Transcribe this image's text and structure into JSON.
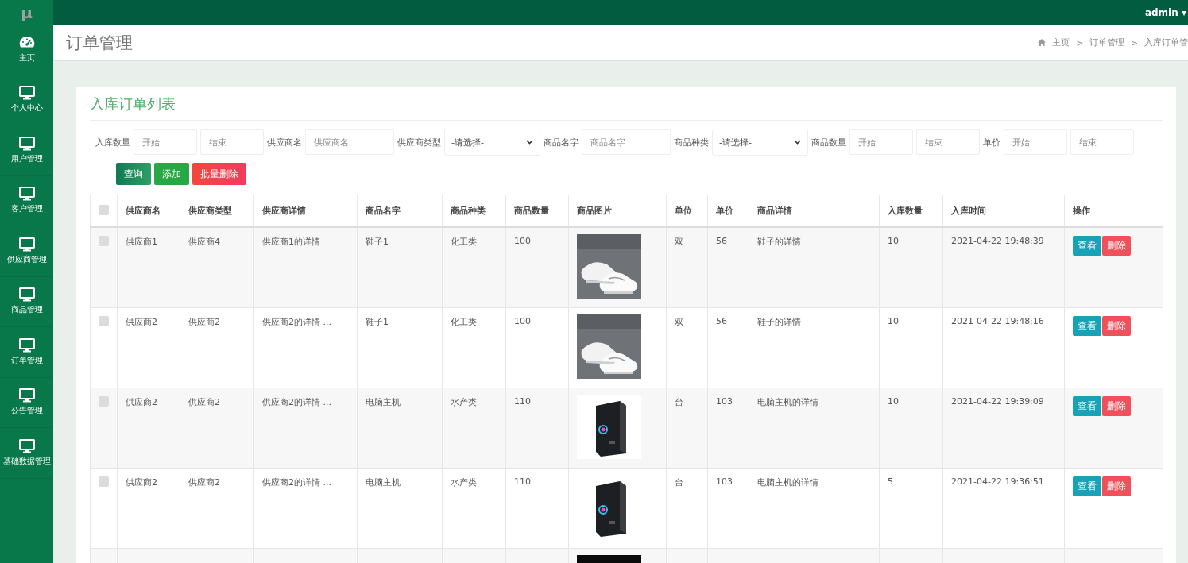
{
  "logo": "μ",
  "user_menu": {
    "label": "admin",
    "caret": "▾"
  },
  "sidebar": {
    "items": [
      {
        "label": "主页"
      },
      {
        "label": "个人中心"
      },
      {
        "label": "用户管理"
      },
      {
        "label": "客户管理"
      },
      {
        "label": "供应商管理"
      },
      {
        "label": "商品管理"
      },
      {
        "label": "订单管理"
      },
      {
        "label": "公告管理"
      },
      {
        "label": "基础数据管理"
      }
    ]
  },
  "page_title": "订单管理",
  "breadcrumb": [
    "主页",
    "订单管理",
    "入库订单管"
  ],
  "breadcrumb_separator": ">",
  "card_title": "入库订单列表",
  "filters": [
    {
      "kind": "range",
      "label": "入库数量",
      "placeholders": [
        "开始",
        "结束"
      ]
    },
    {
      "kind": "text",
      "label": "供应商名",
      "placeholder": "供应商名"
    },
    {
      "kind": "select",
      "label": "供应商类型",
      "value": "-请选择-"
    },
    {
      "kind": "text",
      "label": "商品名字",
      "placeholder": "商品名字"
    },
    {
      "kind": "select",
      "label": "商品种类",
      "value": "-请选择-"
    },
    {
      "kind": "range",
      "label": "商品数量",
      "placeholders": [
        "开始",
        "结束"
      ]
    },
    {
      "kind": "range",
      "label": "单价",
      "placeholders": [
        "开始",
        "结束"
      ]
    }
  ],
  "actions": [
    {
      "label": "查询",
      "kind": "search"
    },
    {
      "label": "添加",
      "kind": "add"
    },
    {
      "label": "批量删除",
      "kind": "delete"
    }
  ],
  "table": {
    "select_all_checked": false,
    "columns": [
      "供应商名",
      "供应商类型",
      "供应商详情",
      "商品名字",
      "商品种类",
      "商品数量",
      "商品图片",
      "单位",
      "单价",
      "商品详情",
      "入库数量",
      "入库时间",
      "操作"
    ],
    "rows": [
      {
        "checked": false,
        "cells": [
          "供应商1",
          "供应商4",
          "供应商1的详情",
          "鞋子1",
          "化工类",
          "100"
        ],
        "cells_after": [
          "双",
          "56",
          "鞋子的详情",
          "10",
          "2021-04-22 19:48:39"
        ],
        "view": "查看",
        "delete": "删除"
      },
      {
        "checked": false,
        "cells": [
          "供应商2",
          "供应商2",
          "供应商2的详情 ...",
          "鞋子1",
          "化工类",
          "100"
        ],
        "cells_after": [
          "双",
          "56",
          "鞋子的详情",
          "10",
          "2021-04-22 19:48:16"
        ],
        "view": "查看",
        "delete": "删除"
      },
      {
        "checked": false,
        "cells": [
          "供应商2",
          "供应商2",
          "供应商2的详情 ...",
          "电脑主机",
          "水产类",
          "110"
        ],
        "cells_after": [
          "台",
          "103",
          "电脑主机的详情",
          "10",
          "2021-04-22 19:39:09"
        ],
        "view": "查看",
        "delete": "删除"
      },
      {
        "checked": false,
        "cells": [
          "供应商2",
          "供应商2",
          "供应商2的详情 ...",
          "电脑主机",
          "水产类",
          "110"
        ],
        "cells_after": [
          "台",
          "103",
          "电脑主机的详情",
          "5",
          "2021-04-22 19:36:51"
        ],
        "view": "查看",
        "delete": "删除"
      },
      {}
    ]
  }
}
